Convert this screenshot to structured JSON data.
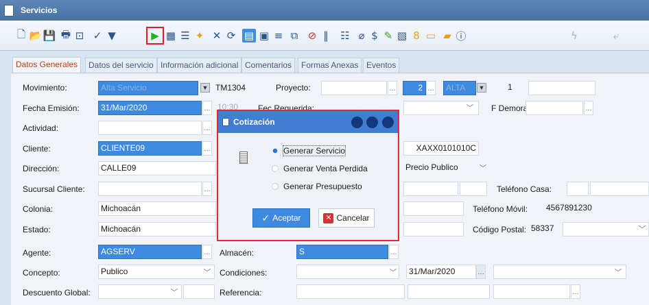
{
  "window": {
    "title": "Servicios"
  },
  "toolbar": {
    "icons": [
      "new-doc-icon",
      "open-folder-icon",
      "save-icon",
      "print-icon",
      "preview-icon",
      "spellcheck-icon",
      "filter-icon",
      "play-icon",
      "grid-icon",
      "form-icon",
      "magic-icon",
      "close-x-icon",
      "refresh-icon",
      "list-view-icon",
      "detail-view-icon",
      "text-view-icon",
      "copy-icon",
      "cancel-icon",
      "barcode-icon",
      "list-icon",
      "attach-icon",
      "price-icon",
      "edit-icon",
      "report-icon",
      "number-icon",
      "folder-icon",
      "export-icon",
      "info-icon",
      "lightning-icon",
      "arrow-icon"
    ]
  },
  "tabs": [
    "Datos Generales",
    "Datos del servicio",
    "Información adicional",
    "Comentarios",
    "Formas Anexas",
    "Eventos"
  ],
  "form": {
    "movimiento_label": "Movimiento:",
    "movimiento_value": "Alta Servicio",
    "movimiento_id": "TM1304",
    "proyecto_label": "Proyecto:",
    "proyecto_num": "2",
    "proyecto_estado": "ALTA",
    "proyecto_count": "1",
    "fecha_label": "Fecha Emisión:",
    "fecha_value": "31/Mar/2020",
    "hora_value": "10:30",
    "fec_req_label": "Fec Requerida:",
    "f_demora_label": "F Demora:",
    "actividad_label": "Actividad:",
    "cliente_label": "Cliente:",
    "cliente_value": "CLIENTE09",
    "rfc_value": "XAXX0101010C",
    "direccion_label": "Dirección:",
    "direccion_value": "CALLE09",
    "precio_value": "Precio Publico",
    "sucursal_label": "Sucursal Cliente:",
    "tel_casa_label": "Teléfono Casa:",
    "colonia_label": "Colonia:",
    "colonia_value": "Michoacán",
    "tel_movil_label": "Teléfono Móvil:",
    "tel_movil_value": "4567891230",
    "estado_label": "Estado:",
    "estado_value": "Michoacán",
    "cp_label": "Código Postal:",
    "cp_value": "58337",
    "agente_label": "Agente:",
    "agente_value": "AGSERV",
    "almacen_label": "Almacén:",
    "almacen_value": "S",
    "concepto_label": "Concepto:",
    "concepto_value": "Publico",
    "condiciones_label": "Condiciones:",
    "fecha2_value": "31/Mar/2020",
    "descuento_label": "Descuento Global:",
    "referencia_label": "Referencia:"
  },
  "dialog": {
    "title": "Cotización",
    "options": [
      "Generar Servicio",
      "Generar Venta Perdida",
      "Generar Presupuesto"
    ],
    "selected": "Generar Servicio",
    "accept": "Aceptar",
    "cancel": "Cancelar"
  },
  "colors": {
    "accent": "#3d8ae0",
    "highlight": "#de2b30",
    "title_bar": "#4a72a3"
  }
}
